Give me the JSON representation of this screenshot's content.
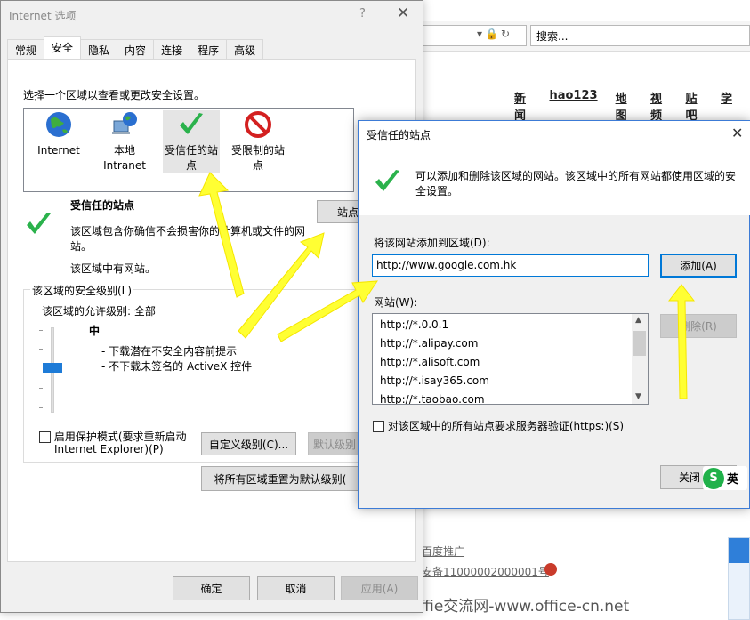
{
  "browser": {
    "search_placeholder": "搜索...",
    "nav": [
      "新闻",
      "hao123",
      "地图",
      "视频",
      "贴吧",
      "学"
    ],
    "footer_link1": "百度推广",
    "footer_link2": "安备11000002000001号",
    "watermark": "Offie交流网-www.office-cn.net"
  },
  "internet_options": {
    "title": "Internet 选项",
    "help": "?",
    "close": "✕",
    "tabs": [
      "常规",
      "安全",
      "隐私",
      "内容",
      "连接",
      "程序",
      "高级"
    ],
    "active_tab": "安全",
    "instruction": "选择一个区域以查看或更改安全设置。",
    "zones": [
      {
        "label": "Internet"
      },
      {
        "label1": "本地",
        "label2": "Intranet"
      },
      {
        "label1": "受信任的站",
        "label2": "点"
      },
      {
        "label1": "受限制的站",
        "label2": "点"
      }
    ],
    "zone_title": "受信任的站点",
    "sites_button": "站点",
    "zone_desc1": "该区域包含你确信不会损害你的计算机或文件的网",
    "zone_desc2": "站。",
    "zone_has_sites": "该区域中有网站。",
    "security_group_label": "该区域的安全级别(L)",
    "allowed_levels": "该区域的允许级别: 全部",
    "level_name": "中",
    "level_bullets": [
      "- 下载潜在不安全内容前提示",
      "- 不下载未签名的 ActiveX 控件"
    ],
    "protected_mode_line1": "启用保护模式(要求重新启动",
    "protected_mode_line2": "Internet Explorer)(P)",
    "custom_level_button": "自定义级别(C)...",
    "default_level_button": "默认级别",
    "reset_all_button": "将所有区域重置为默认级别(",
    "ok_button": "确定",
    "cancel_button": "取消",
    "apply_button": "应用(A)"
  },
  "trusted_sites": {
    "title": "受信任的站点",
    "close": "✕",
    "info1": "可以添加和删除该区域的网站。该区域中的所有网站都使用区域的安",
    "info2": "全设置。",
    "add_label": "将该网站添加到区域(D):",
    "add_value": "http://www.google.com.hk",
    "add_button": "添加(A)",
    "websites_label": "网站(W):",
    "websites": [
      "http://*.0.0.1",
      "http://*.alipay.com",
      "http://*.alisoft.com",
      "http://*.isay365.com",
      "http://*.taobao.com"
    ],
    "remove_button": "删除(R)",
    "https_checkbox": "对该区域中的所有站点要求服务器验证(https:)(S)",
    "close_button": "关闭",
    "ime_label": "英"
  },
  "colors": {
    "arrow": "#ffff33",
    "accent": "#0078d7",
    "check_green": "#2bb24c"
  }
}
